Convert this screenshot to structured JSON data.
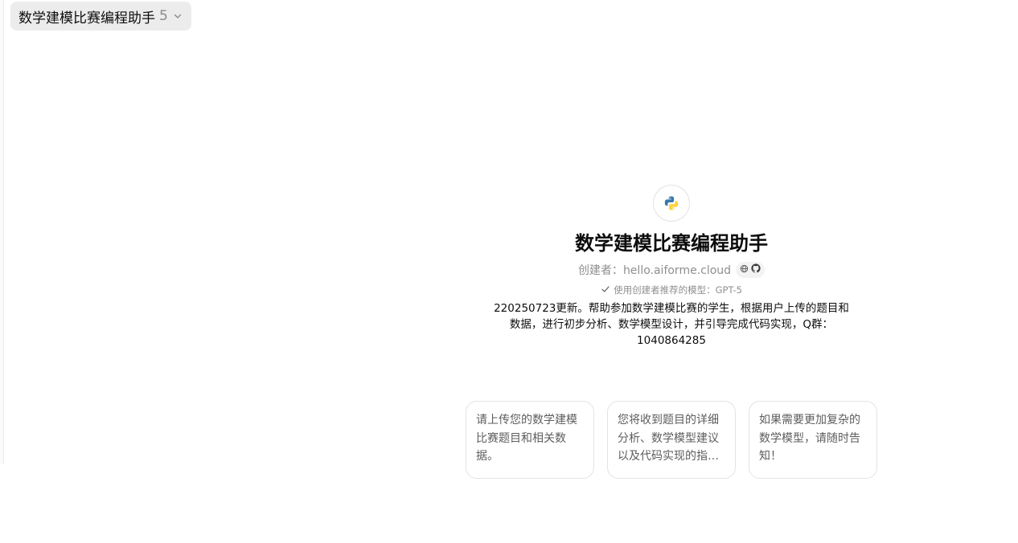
{
  "header": {
    "model_name": "数学建模比赛编程助手",
    "model_version": "5"
  },
  "gpt": {
    "title": "数学建模比赛编程助手",
    "creator_label": "创建者：",
    "creator_name": "hello.aiforme.cloud",
    "model_note": "使用创建者推荐的模型：GPT-5",
    "description": "220250723更新。帮助参加数学建模比赛的学生，根据用户上传的题目和数据，进行初步分析、数学模型设计，并引导完成代码实现，Q群：1040864285"
  },
  "starters": [
    {
      "text": "请上传您的数学建模比赛题目和相关数据。"
    },
    {
      "text": "您将收到题目的详细分析、数学模型建议以及代码实现的指导。"
    },
    {
      "text": "如果需要更加复杂的数学模型，请随时告知！"
    }
  ],
  "icons": {
    "avatar": "python-logo-icon",
    "chevron": "chevron-down-icon",
    "web": "globe-icon",
    "github": "github-icon",
    "check": "check-icon"
  },
  "colors": {
    "python_blue": "#3776ab",
    "python_yellow": "#ffd43b",
    "selector_bg": "#ececec"
  }
}
